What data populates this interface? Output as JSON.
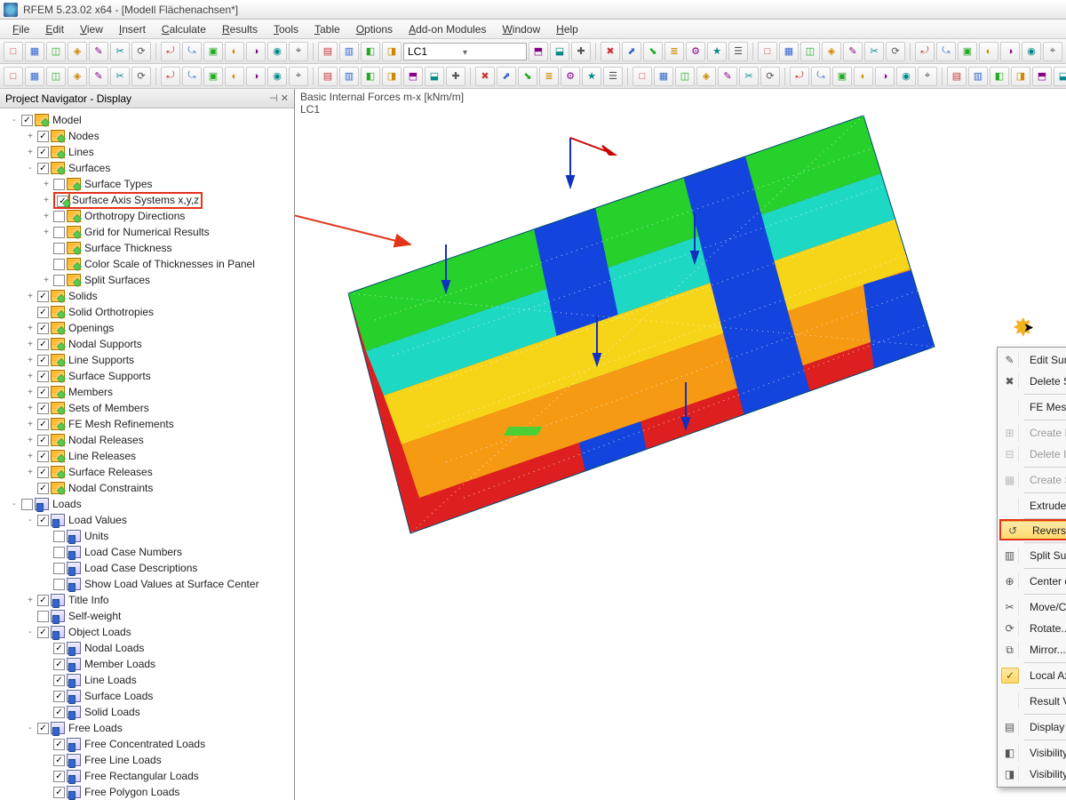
{
  "app": {
    "title": "RFEM 5.23.02 x64 - [Modell Flächenachsen*]"
  },
  "menu": {
    "items": [
      "File",
      "Edit",
      "View",
      "Insert",
      "Calculate",
      "Results",
      "Tools",
      "Table",
      "Options",
      "Add-on Modules",
      "Window",
      "Help"
    ]
  },
  "toolbar": {
    "combo_value": "LC1"
  },
  "navigator": {
    "title": "Project Navigator - Display",
    "tree": [
      {
        "d": 0,
        "exp": "-",
        "chk": true,
        "ico": "m",
        "label": "Model"
      },
      {
        "d": 1,
        "exp": "+",
        "chk": true,
        "ico": "m",
        "label": "Nodes"
      },
      {
        "d": 1,
        "exp": "+",
        "chk": true,
        "ico": "m",
        "label": "Lines"
      },
      {
        "d": 1,
        "exp": "-",
        "chk": true,
        "ico": "m",
        "label": "Surfaces"
      },
      {
        "d": 2,
        "exp": "+",
        "chk": false,
        "ico": "m",
        "label": "Surface Types"
      },
      {
        "d": 2,
        "exp": "+",
        "chk": true,
        "ico": "m",
        "label": "Surface Axis Systems x,y,z",
        "hl": true
      },
      {
        "d": 2,
        "exp": "+",
        "chk": false,
        "ico": "m",
        "label": "Orthotropy Directions"
      },
      {
        "d": 2,
        "exp": "+",
        "chk": false,
        "ico": "m",
        "label": "Grid for Numerical Results"
      },
      {
        "d": 2,
        "exp": "",
        "chk": false,
        "ico": "m",
        "label": "Surface Thickness"
      },
      {
        "d": 2,
        "exp": "",
        "chk": false,
        "ico": "m",
        "label": "Color Scale of Thicknesses in Panel"
      },
      {
        "d": 2,
        "exp": "+",
        "chk": false,
        "ico": "m",
        "label": "Split Surfaces"
      },
      {
        "d": 1,
        "exp": "+",
        "chk": true,
        "ico": "m",
        "label": "Solids"
      },
      {
        "d": 1,
        "exp": "",
        "chk": true,
        "ico": "m",
        "label": "Solid Orthotropies"
      },
      {
        "d": 1,
        "exp": "+",
        "chk": true,
        "ico": "m",
        "label": "Openings"
      },
      {
        "d": 1,
        "exp": "+",
        "chk": true,
        "ico": "m",
        "label": "Nodal Supports"
      },
      {
        "d": 1,
        "exp": "+",
        "chk": true,
        "ico": "m",
        "label": "Line Supports"
      },
      {
        "d": 1,
        "exp": "+",
        "chk": true,
        "ico": "m",
        "label": "Surface Supports"
      },
      {
        "d": 1,
        "exp": "+",
        "chk": true,
        "ico": "m",
        "label": "Members"
      },
      {
        "d": 1,
        "exp": "+",
        "chk": true,
        "ico": "m",
        "label": "Sets of Members"
      },
      {
        "d": 1,
        "exp": "+",
        "chk": true,
        "ico": "m",
        "label": "FE Mesh Refinements"
      },
      {
        "d": 1,
        "exp": "+",
        "chk": true,
        "ico": "m",
        "label": "Nodal Releases"
      },
      {
        "d": 1,
        "exp": "+",
        "chk": true,
        "ico": "m",
        "label": "Line Releases"
      },
      {
        "d": 1,
        "exp": "+",
        "chk": true,
        "ico": "m",
        "label": "Surface Releases"
      },
      {
        "d": 1,
        "exp": "",
        "chk": true,
        "ico": "m",
        "label": "Nodal Constraints"
      },
      {
        "d": 0,
        "exp": "-",
        "chk": false,
        "ico": "l",
        "label": "Loads"
      },
      {
        "d": 1,
        "exp": "-",
        "chk": true,
        "ico": "l",
        "label": "Load Values"
      },
      {
        "d": 2,
        "exp": "",
        "chk": false,
        "ico": "l",
        "label": "Units"
      },
      {
        "d": 2,
        "exp": "",
        "chk": false,
        "ico": "l",
        "label": "Load Case Numbers"
      },
      {
        "d": 2,
        "exp": "",
        "chk": false,
        "ico": "l",
        "label": "Load Case Descriptions"
      },
      {
        "d": 2,
        "exp": "",
        "chk": false,
        "ico": "l",
        "label": "Show Load Values at Surface Center"
      },
      {
        "d": 1,
        "exp": "+",
        "chk": true,
        "ico": "l",
        "label": "Title Info"
      },
      {
        "d": 1,
        "exp": "",
        "chk": false,
        "ico": "l",
        "label": "Self-weight"
      },
      {
        "d": 1,
        "exp": "-",
        "chk": true,
        "ico": "l",
        "label": "Object Loads"
      },
      {
        "d": 2,
        "exp": "",
        "chk": true,
        "ico": "l",
        "label": "Nodal Loads"
      },
      {
        "d": 2,
        "exp": "",
        "chk": true,
        "ico": "l",
        "label": "Member Loads"
      },
      {
        "d": 2,
        "exp": "",
        "chk": true,
        "ico": "l",
        "label": "Line Loads"
      },
      {
        "d": 2,
        "exp": "",
        "chk": true,
        "ico": "l",
        "label": "Surface Loads"
      },
      {
        "d": 2,
        "exp": "",
        "chk": true,
        "ico": "l",
        "label": "Solid Loads"
      },
      {
        "d": 1,
        "exp": "-",
        "chk": true,
        "ico": "l",
        "label": "Free Loads"
      },
      {
        "d": 2,
        "exp": "",
        "chk": true,
        "ico": "l",
        "label": "Free Concentrated Loads"
      },
      {
        "d": 2,
        "exp": "",
        "chk": true,
        "ico": "l",
        "label": "Free Line Loads"
      },
      {
        "d": 2,
        "exp": "",
        "chk": true,
        "ico": "l",
        "label": "Free Rectangular Loads"
      },
      {
        "d": 2,
        "exp": "",
        "chk": true,
        "ico": "l",
        "label": "Free Polygon Loads"
      }
    ]
  },
  "viewport": {
    "label_line1": "Basic Internal Forces m-x [kNm/m]",
    "label_line2": "LC1"
  },
  "context_menu": {
    "items": [
      {
        "icon": "✎",
        "label": "Edit Surface...",
        "enabled": true
      },
      {
        "icon": "✖",
        "label": "Delete Surface",
        "enabled": true
      },
      {
        "sep": true
      },
      {
        "icon": "",
        "label": "FE Mesh Refinement",
        "enabled": true,
        "sub": true
      },
      {
        "sep": true
      },
      {
        "icon": "⊞",
        "label": "Create Intersection...",
        "enabled": false
      },
      {
        "icon": "⊟",
        "label": "Delete Intersection",
        "enabled": false
      },
      {
        "sep": true
      },
      {
        "icon": "▦",
        "label": "Create Solid with Contact...",
        "enabled": false
      },
      {
        "sep": true
      },
      {
        "icon": "",
        "label": "Extrude",
        "enabled": true,
        "sub": true
      },
      {
        "sep": true
      },
      {
        "icon": "↺",
        "label": "Reverse Local Axis System",
        "enabled": true,
        "hl": true,
        "boxed": true
      },
      {
        "sep": true
      },
      {
        "icon": "▥",
        "label": "Split Surface...",
        "enabled": true
      },
      {
        "sep": true
      },
      {
        "icon": "⊕",
        "label": "Center of Gravity and Info...",
        "enabled": true
      },
      {
        "sep": true
      },
      {
        "icon": "✂",
        "label": "Move/Copy...",
        "enabled": true
      },
      {
        "icon": "⟳",
        "label": "Rotate...",
        "enabled": true
      },
      {
        "icon": "⧉",
        "label": "Mirror...",
        "enabled": true
      },
      {
        "sep": true
      },
      {
        "icon": "✓",
        "label": "Local Axis Systems on/off",
        "enabled": true,
        "check": true
      },
      {
        "sep": true
      },
      {
        "icon": "",
        "label": "Result Values",
        "enabled": true,
        "sub": true
      },
      {
        "sep": true
      },
      {
        "icon": "▤",
        "label": "Display Properties...",
        "enabled": true
      },
      {
        "sep": true
      },
      {
        "icon": "◧",
        "label": "Visibility by Selected Objects",
        "enabled": true
      },
      {
        "icon": "◨",
        "label": "Visibility by Hiding Selected Objects",
        "enabled": true
      }
    ]
  }
}
